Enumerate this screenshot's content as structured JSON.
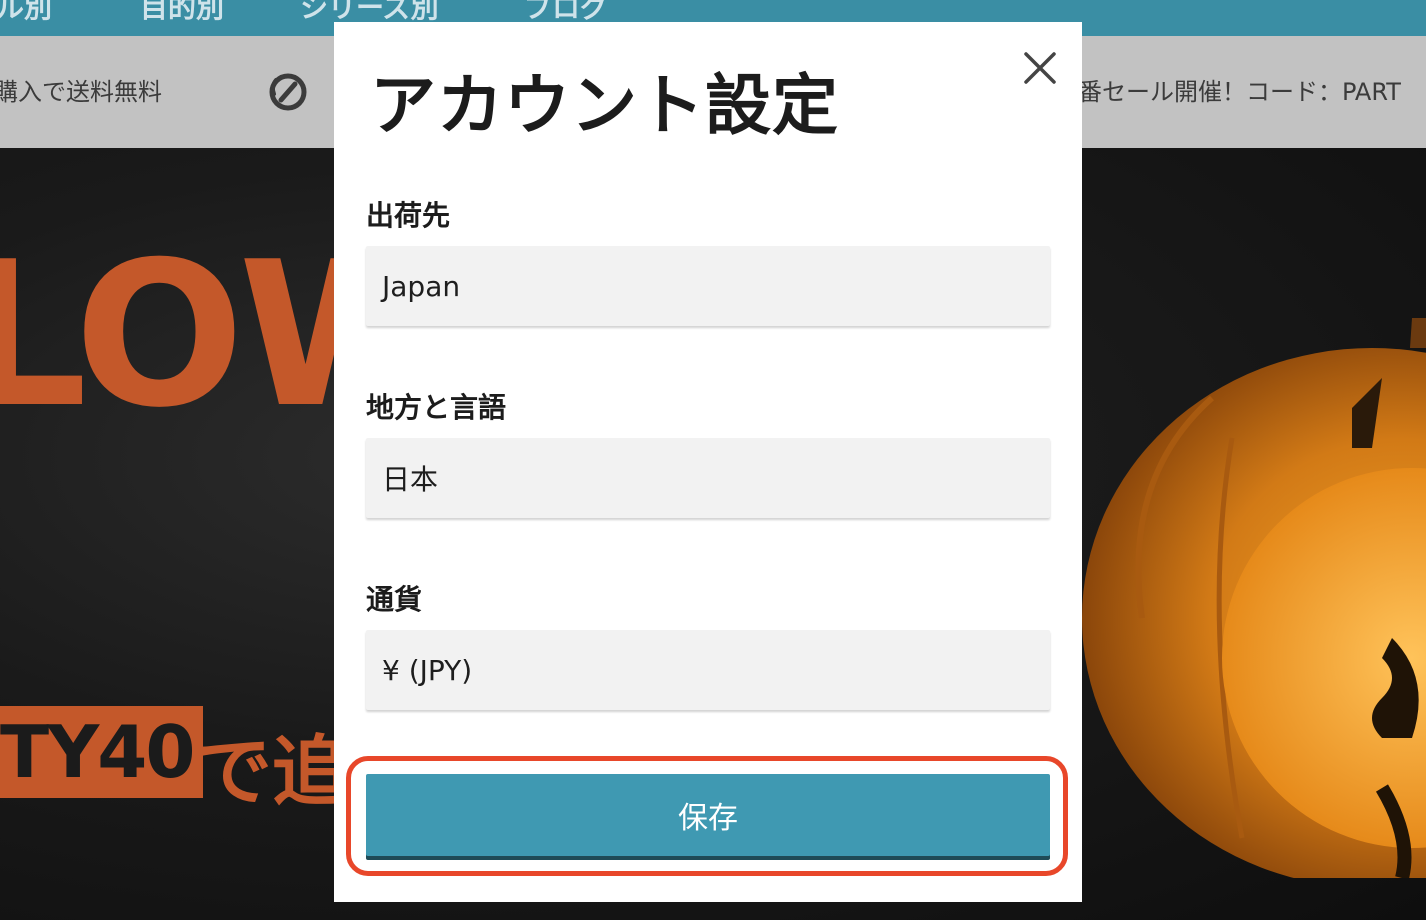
{
  "background": {
    "nav": {
      "items": [
        "ル別",
        "目的別",
        "シリーズ別",
        "ブログ"
      ]
    },
    "promo": {
      "left_text": "購入で送料無料",
      "right_text": "番セール開催！コード：PART"
    },
    "hero": {
      "headline": "LOW",
      "code": "TY40",
      "suffix": "で追"
    }
  },
  "modal": {
    "title": "アカウント設定",
    "fields": [
      {
        "label": "出荷先",
        "value": "Japan"
      },
      {
        "label": "地方と言語",
        "value": "日本"
      },
      {
        "label": "通貨",
        "value": "¥ (JPY)"
      }
    ],
    "save_label": "保存"
  },
  "colors": {
    "nav_bg": "#3a8ea4",
    "promo_bg": "#c2c2c2",
    "accent_orange": "#c4582a",
    "save_bg": "#3f99b2",
    "highlight": "#e8472a"
  },
  "icons": {
    "close": "close-icon",
    "promo": "no-fee-icon"
  }
}
